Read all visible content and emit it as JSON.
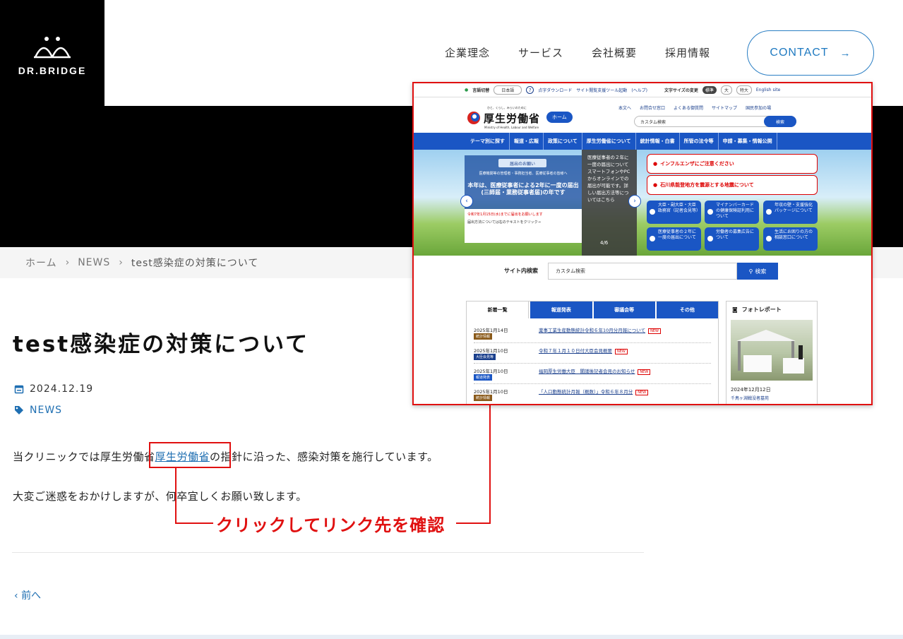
{
  "header": {
    "logo_text": "DR.BRIDGE",
    "nav": [
      "企業理念",
      "サービス",
      "会社概要",
      "採用情報"
    ],
    "contact_label": "CONTACT"
  },
  "breadcrumb": {
    "home": "ホーム",
    "section": "NEWS",
    "current": "test感染症の対策について"
  },
  "article": {
    "title": "test感染症の対策について",
    "date": "2024.12.19",
    "category": "NEWS",
    "para1_before": "当クリニックでは厚生労働省",
    "para1_link": "厚生労働省",
    "para1_after": "の指針に沿った、感染対策を施行しています。",
    "para2": "大変ご迷惑をおかけしますが、何卒宜しくお願い致します。",
    "prev_label": "前へ"
  },
  "annotation": {
    "text": "クリックしてリンク先を確認",
    "color": "#e01010"
  },
  "embedded_site": {
    "top_bar": {
      "lang_label": "言語切替",
      "lang_value": "日本語",
      "links": [
        "点字ダウンロード",
        "サイト閲覧支援ツール起動",
        "(ヘルプ)"
      ],
      "font_label": "文字サイズの変更",
      "font_sizes": [
        "標準",
        "大",
        "特大"
      ],
      "english": "English site"
    },
    "logo_tagline": "ひと、くらし、みらいのために",
    "logo_text": "厚生労働省",
    "logo_en": "Ministry of Health, Labour and Welfare",
    "home_button": "ホーム",
    "header_links": [
      "本文へ",
      "お問合せ窓口",
      "よくある御質問",
      "サイトマップ",
      "国民参加の場"
    ],
    "search_placeholder": "カスタム検索",
    "search_button": "検索",
    "menu": [
      "テーマ別に探す",
      "報道・広報",
      "政策について",
      "厚生労働省について",
      "統計情報・白書",
      "所管の法令等",
      "申請・募集・情報公開"
    ],
    "notice": {
      "tag": "届出のお願い",
      "sub": "医療機関等の管理者・事務担当者、医療従事者の皆様へ",
      "main": "本年は、医療従事者による2年に一度の届出(三師届・業務従事者届)の年です",
      "deadline": "令和7年1月15日(水)までに届出をお願いします",
      "note": "届出方法については右のテキストをクリック→"
    },
    "dark_panel_text": "医療従事者の２年に一度の届出について スマートフォンやPCからオンラインでの届出が可能です。詳しい届出方法等についてはこちら",
    "slide_counter": "4/6",
    "alerts": [
      "インフルエンザにご注意ください",
      "石川県能登地方を震源とする地震について"
    ],
    "tiles": [
      "大臣・副大臣・大臣政務官（記者会見等）",
      "マイナンバーカードの健康保険証利用について",
      "年収の壁・支援強化パッケージについて",
      "医療従事者の２年に一度の届出について",
      "労働者の募集広告について",
      "生活にお困りの方の相談窓口について"
    ],
    "site_search_label": "サイト内検索",
    "tabs": [
      "新着一覧",
      "報道発表",
      "審議会等",
      "その他"
    ],
    "news": [
      {
        "date": "2025年1月14日",
        "tag": "統計情報",
        "tag_color": "#8a5a1a",
        "text": "薬事工業生産動態統計令和６年10月分月報について"
      },
      {
        "date": "2025年1月10日",
        "tag": "大臣会見等",
        "tag_color": "#1a3f8c",
        "text": "令和７年１月１０日付大臣会見概要"
      },
      {
        "date": "2025年1月10日",
        "tag": "報道発表",
        "tag_color": "#1a56c4",
        "text": "福岡厚生労働大臣　閣議後記者会見のお知らせ"
      },
      {
        "date": "2025年1月10日",
        "tag": "統計情報",
        "tag_color": "#8a5a1a",
        "text": "「人口動態統計月報（概数）」令和６年８月分"
      }
    ],
    "new_badge": "NEW",
    "photo_report": {
      "title": "フォトレポート",
      "date": "2024年12月12日",
      "caption": "千鳥ヶ淵戦没者墓苑"
    }
  }
}
